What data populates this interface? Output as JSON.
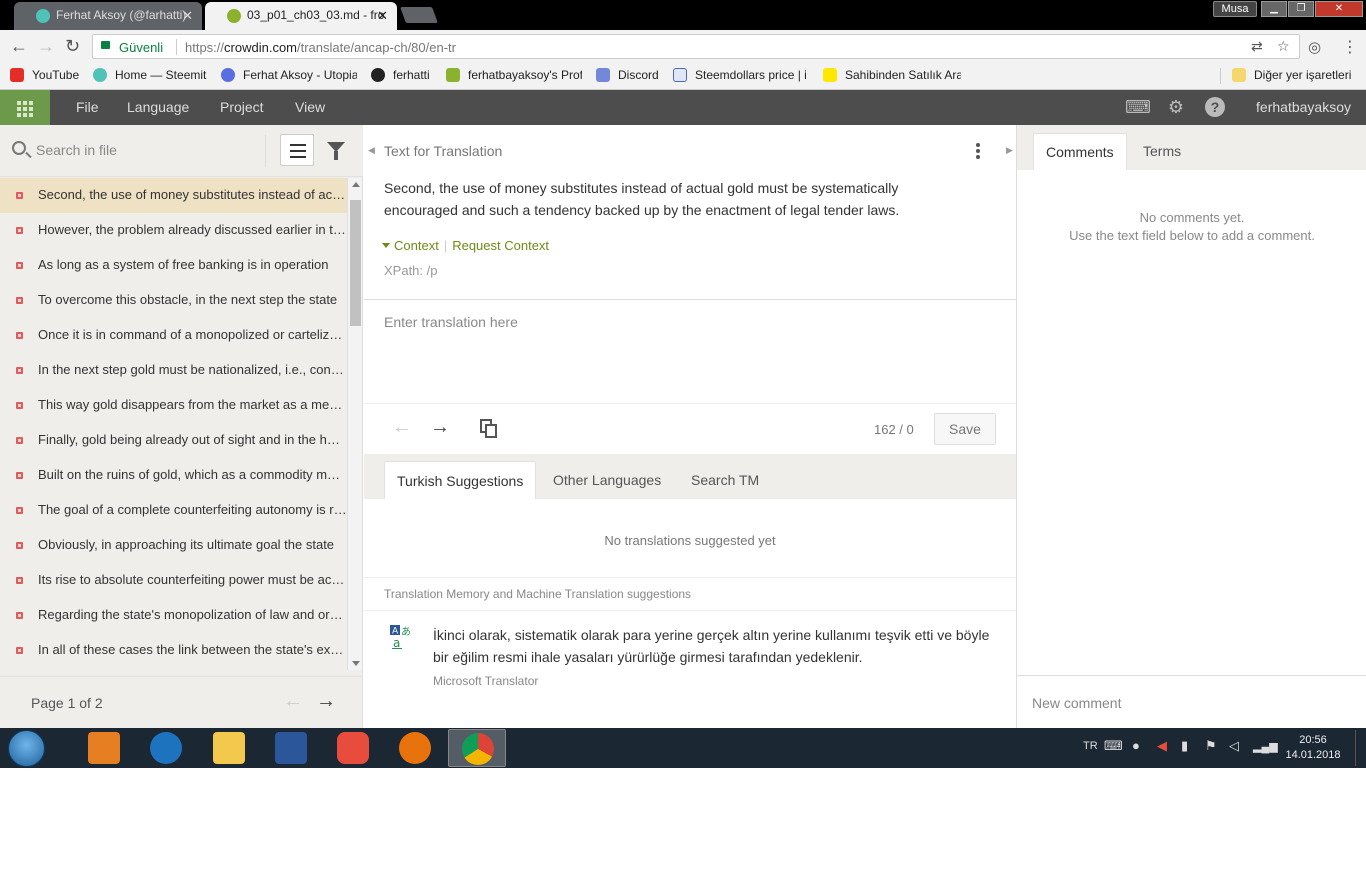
{
  "browser": {
    "tabs": [
      {
        "title": "Ferhat Aksoy (@farhatti) ×",
        "label": "Ferhat Aksoy (@farhatti)",
        "active": false
      },
      {
        "title": "03_p01_ch03_03.md - fro",
        "label": "03_p01_ch03_03.md - fro",
        "active": true
      }
    ],
    "user_badge": "Musa",
    "secure_label": "Güvenli",
    "url_scheme": "https://",
    "url_domain": "crowdin.com",
    "url_path": "/translate/ancap-ch/80/en-tr",
    "bookmarks": [
      "YouTube",
      "Home — Steemit",
      "Ferhat Aksoy - Utopia",
      "ferhatti",
      "ferhatbayaksoy's Prof",
      "Discord",
      "Steemdollars price | i",
      "Sahibinden Satılık Ara"
    ],
    "other_bookmarks": "Diğer yer işaretleri"
  },
  "app": {
    "menu": [
      "File",
      "Language",
      "Project",
      "View"
    ],
    "username": "ferhatbayaksoy"
  },
  "left_panel": {
    "search_placeholder": "Search in file",
    "strings": [
      "Second, the use of money substitutes instead of actual gold must be systematically encouraged",
      "However, the problem already discussed earlier in this chapter remains",
      "As long as a system of free banking is in operation",
      "To overcome this obstacle, in the next step the state",
      "Once it is in command of a monopolized or cartelized banking system",
      "In the next step gold must be nationalized, i.e., confiscated",
      "This way gold disappears from the market as a medium of exchange",
      "Finally, gold being already out of sight and in the hands of the state",
      "Built on the ruins of gold, which as a commodity money",
      "The goal of a complete counterfeiting autonomy is reached",
      "Obviously, in approaching its ultimate goal the state",
      "Its rise to absolute counterfeiting power must be accompanied",
      "Regarding the state's monopolization of law and order",
      "In all of these cases the link between the state's expanded power"
    ],
    "page_label": "Page 1 of 2"
  },
  "editor": {
    "source_title": "Text for Translation",
    "source_text": "Second, the use of money substitutes instead of actual gold must be systematically encouraged and such a tendency backed up by the enactment of legal tender laws.",
    "context_label": "Context",
    "request_context_label": "Request Context",
    "xpath": "XPath: /p",
    "translation_placeholder": "Enter translation here",
    "counter": "162 / 0",
    "save_label": "Save",
    "suggestion_tabs": [
      "Turkish Suggestions",
      "Other Languages",
      "Search TM"
    ],
    "no_suggestions": "No translations suggested yet",
    "tm_header": "Translation Memory and Machine Translation suggestions",
    "mt_text": "İkinci olarak, sistematik olarak para yerine gerçek altın yerine kullanımı teşvik etti ve böyle bir eğilim resmi ihale yasaları yürürlüğe girmesi tarafından yedeklenir.",
    "mt_source": "Microsoft Translator"
  },
  "right_panel": {
    "tabs": [
      "Comments",
      "Terms"
    ],
    "no_comments_1": "No comments yet.",
    "no_comments_2": "Use the text field below to add a comment.",
    "new_comment_placeholder": "New comment"
  },
  "taskbar": {
    "lang": "TR",
    "time": "20:56",
    "date": "14.01.2018"
  },
  "colors": {
    "app_header": "#4d4d4d",
    "grid_button": "#6c9a4a",
    "selected_string": "#efe2c4",
    "untranslated_dot": "#e05c5c",
    "context_link": "#6f8a17",
    "secure_green": "#0b8043"
  }
}
